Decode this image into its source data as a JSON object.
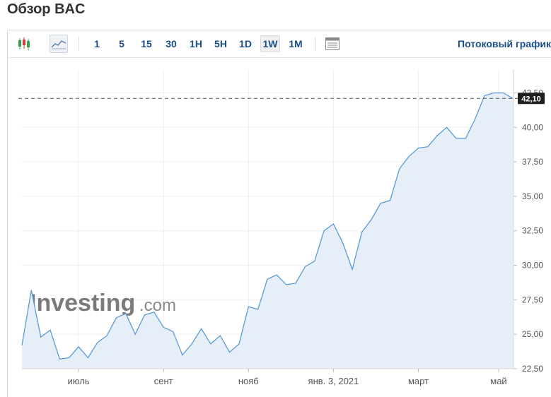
{
  "page_title": "Обзор BAC",
  "toolbar": {
    "candles_icon": "candlestick-chart-icon",
    "line_icon": "line-chart-icon",
    "timeframes": [
      "1",
      "5",
      "15",
      "30",
      "1H",
      "5H",
      "1D",
      "1W",
      "1M"
    ],
    "active_timeframe": "1W",
    "table_icon": "data-table-icon",
    "stream_label": "Потоковый график"
  },
  "watermark": {
    "main": "Investing",
    "suffix": ".com"
  },
  "colors": {
    "line": "#5b9bd5",
    "area": "#e6eef7",
    "price_tag": "#1f1f1f",
    "accent_text": "#1a4e8a",
    "candle_up": "#3ca04a",
    "candle_down": "#d9383a"
  },
  "chart_data": {
    "type": "area",
    "ylim": [
      22.5,
      43.6
    ],
    "y_ticks": [
      "22,50",
      "25,00",
      "27,50",
      "30,00",
      "32,50",
      "35,00",
      "37,50",
      "40,00",
      "42,50"
    ],
    "y_tick_values": [
      22.5,
      25,
      27.5,
      30,
      32.5,
      35,
      37.5,
      40,
      42.5
    ],
    "x_ticks": [
      "июль",
      "сент",
      "нояб",
      "янв. 3, 2021",
      "март",
      "май"
    ],
    "x_tick_index": [
      6,
      15,
      24,
      33,
      42,
      50.5
    ],
    "current_price": 42.1,
    "current_price_label": "42,10",
    "values": [
      24.2,
      28.2,
      24.8,
      25.3,
      23.2,
      23.3,
      24.1,
      23.3,
      24.4,
      24.9,
      26.2,
      26.5,
      25.0,
      26.4,
      26.6,
      25.5,
      25.2,
      23.5,
      24.3,
      25.4,
      24.3,
      24.9,
      23.7,
      24.3,
      27.0,
      26.8,
      29.0,
      29.3,
      28.6,
      28.7,
      29.9,
      30.3,
      32.5,
      33.0,
      31.6,
      29.7,
      32.4,
      33.3,
      34.5,
      34.7,
      37.0,
      37.9,
      38.5,
      38.6,
      39.4,
      40.0,
      39.2,
      39.2,
      40.6,
      42.3,
      42.5,
      42.5,
      42.1
    ]
  }
}
